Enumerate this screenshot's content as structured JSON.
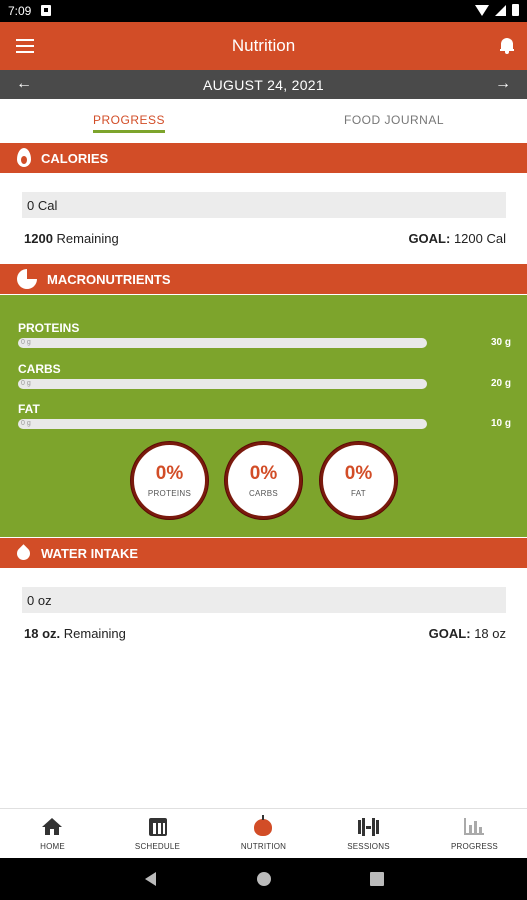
{
  "status_bar": {
    "time": "7:09"
  },
  "app_bar": {
    "title": "Nutrition"
  },
  "date_bar": {
    "date": "AUGUST 24, 2021",
    "prev_arrow": "←",
    "next_arrow": "→"
  },
  "tabs": [
    {
      "label": "PROGRESS",
      "active": true
    },
    {
      "label": "FOOD JOURNAL",
      "active": false
    }
  ],
  "calories": {
    "header": "CALORIES",
    "value": "0 Cal",
    "remaining_value": "1200",
    "remaining_label": "Remaining",
    "goal_label": "GOAL:",
    "goal_value": "1200 Cal"
  },
  "macronutrients": {
    "header": "MACRONUTRIENTS",
    "items": [
      {
        "label": "PROTEINS",
        "value": "0 g",
        "goal": "30 g",
        "progress": 0
      },
      {
        "label": "CARBS",
        "value": "0 g",
        "goal": "20 g",
        "progress": 0
      },
      {
        "label": "FAT",
        "value": "0 g",
        "goal": "10 g",
        "progress": 0
      }
    ],
    "rings": [
      {
        "pct": "0%",
        "label": "PROTEINS"
      },
      {
        "pct": "0%",
        "label": "CARBS"
      },
      {
        "pct": "0%",
        "label": "FAT"
      }
    ]
  },
  "water": {
    "header": "WATER INTAKE",
    "value": "0 oz",
    "remaining_value": "18 oz.",
    "remaining_label": "Remaining",
    "goal_label": "GOAL:",
    "goal_value": "18 oz"
  },
  "bottom_nav": [
    {
      "label": "HOME",
      "icon": "home-icon"
    },
    {
      "label": "SCHEDULE",
      "icon": "calendar-icon"
    },
    {
      "label": "NUTRITION",
      "icon": "apple-icon",
      "active": true
    },
    {
      "label": "SESSIONS",
      "icon": "dumbbell-icon"
    },
    {
      "label": "PROGRESS",
      "icon": "bar-chart-icon"
    }
  ],
  "colors": {
    "primary": "#d24d27",
    "accent_green": "#7da42c",
    "date_bar": "#4a4a4a"
  }
}
